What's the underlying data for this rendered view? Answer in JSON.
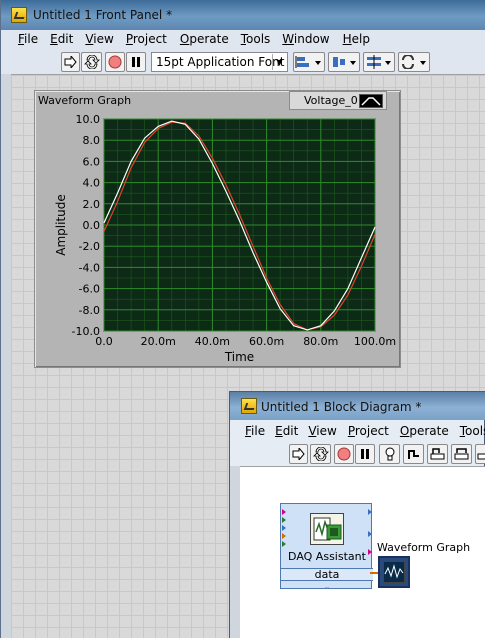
{
  "front_panel": {
    "title": "Untitled 1 Front Panel *",
    "menu": [
      "File",
      "Edit",
      "View",
      "Project",
      "Operate",
      "Tools",
      "Window",
      "Help"
    ],
    "menu_underline": [
      "F",
      "E",
      "V",
      "P",
      "O",
      "T",
      "W",
      "H"
    ],
    "font_select": "15pt Application Font"
  },
  "graph": {
    "label": "Waveform Graph",
    "legend": "Voltage_0",
    "xlabel": "Time",
    "ylabel": "Amplitude"
  },
  "chart_data": {
    "type": "line",
    "xlabel": "Time",
    "ylabel": "Amplitude",
    "xlim": [
      0.0,
      0.1
    ],
    "ylim": [
      -10.0,
      10.0
    ],
    "x_ticks": [
      "0.0",
      "20.0m",
      "40.0m",
      "60.0m",
      "80.0m",
      "100.0m"
    ],
    "y_ticks": [
      "10.0",
      "8.0",
      "6.0",
      "4.0",
      "2.0",
      "0.0",
      "-2.0",
      "-4.0",
      "-6.0",
      "-8.0",
      "-10.0"
    ],
    "grid": true,
    "background": "#0d2a16",
    "grid_color": "#2f8a2a",
    "series": [
      {
        "name": "Voltage_0",
        "color": "#ffffff",
        "x": [
          0.0,
          0.005,
          0.01,
          0.015,
          0.02,
          0.025,
          0.03,
          0.035,
          0.04,
          0.045,
          0.05,
          0.055,
          0.06,
          0.065,
          0.07,
          0.075,
          0.08,
          0.085,
          0.09,
          0.095,
          0.1
        ],
        "values": [
          0.2,
          3.0,
          6.0,
          8.2,
          9.3,
          9.8,
          9.5,
          8.1,
          5.8,
          3.2,
          0.4,
          -2.6,
          -5.4,
          -7.9,
          -9.5,
          -9.9,
          -9.5,
          -8.1,
          -6.0,
          -3.1,
          -0.2
        ]
      },
      {
        "color": "#e0442a",
        "x": [
          0.0,
          0.005,
          0.01,
          0.015,
          0.02,
          0.025,
          0.03,
          0.035,
          0.04,
          0.045,
          0.05,
          0.055,
          0.06,
          0.065,
          0.07,
          0.075,
          0.08,
          0.085,
          0.09,
          0.095,
          0.1
        ],
        "values": [
          -0.6,
          2.2,
          5.4,
          7.8,
          9.1,
          9.7,
          9.6,
          8.4,
          6.3,
          3.8,
          1.0,
          -2.0,
          -5.0,
          -7.5,
          -9.3,
          -9.9,
          -9.6,
          -8.5,
          -6.6,
          -3.9,
          -0.9
        ]
      }
    ]
  },
  "block_diagram": {
    "title": "Untitled 1 Block Diagram *",
    "menu": [
      "File",
      "Edit",
      "View",
      "Project",
      "Operate",
      "Tools"
    ],
    "menu_underline": [
      "F",
      "E",
      "V",
      "P",
      "O",
      "T"
    ],
    "daq_label": "DAQ Assistant",
    "daq_output": "data",
    "graph_terminal_label": "Waveform Graph"
  },
  "colors": {
    "titlebar": "#5d87b1",
    "plot_bg": "#0d2a16",
    "grid": "#2f8a2a",
    "daq_node": "#cfe1f7",
    "wire": "#d66a00"
  }
}
